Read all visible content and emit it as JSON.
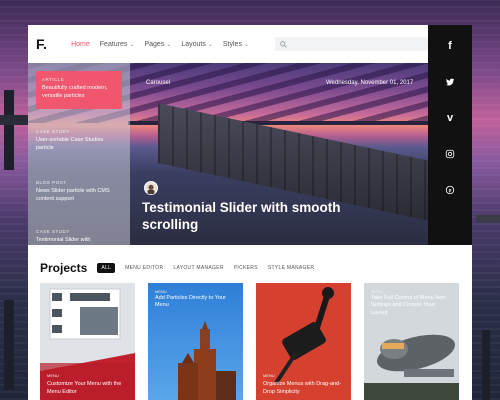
{
  "header": {
    "logo": "F.",
    "nav": [
      {
        "label": "Home",
        "dropdown": false,
        "active": true
      },
      {
        "label": "Features",
        "dropdown": true,
        "active": false
      },
      {
        "label": "Pages",
        "dropdown": true,
        "active": false
      },
      {
        "label": "Layouts",
        "dropdown": true,
        "active": false
      },
      {
        "label": "Styles",
        "dropdown": true,
        "active": false
      }
    ],
    "search": {
      "placeholder": "",
      "icon": "search-icon"
    }
  },
  "social": [
    {
      "name": "facebook-icon",
      "glyph": "f"
    },
    {
      "name": "twitter-icon",
      "glyph": "t"
    },
    {
      "name": "vimeo-icon",
      "glyph": "v"
    },
    {
      "name": "instagram-icon",
      "glyph": "◎"
    },
    {
      "name": "pinterest-icon",
      "glyph": "℗"
    }
  ],
  "hero": {
    "category": "Carousel",
    "date": "Wednesday, November 01, 2017",
    "title": "Testimonial Slider with smooth scrolling",
    "sidebar": [
      {
        "category": "Article",
        "title": "Beautifully crafted modern, versatile particles",
        "active": true
      },
      {
        "category": "Case Study",
        "title": "User-sortable Case Studies particle",
        "active": false
      },
      {
        "category": "Blog Post",
        "title": "News Slider particle with CMS content support",
        "active": false
      },
      {
        "category": "Case Study",
        "title": "Testimonial Slider with",
        "active": false
      }
    ]
  },
  "projects": {
    "title": "Projects",
    "filters": [
      "ALL",
      "MENU EDITOR",
      "LAYOUT MANAGER",
      "PICKERS",
      "STYLE MANAGER"
    ],
    "tiles": [
      {
        "category": "Menu",
        "title": "Customize Your Menu with the Menu Editor",
        "title_pos": "bottom"
      },
      {
        "category": "Menu",
        "title": "Add Particles Directly to Your Menu",
        "title_pos": "top"
      },
      {
        "category": "Menu",
        "title": "Organize Menus with Drag-and-Drop Simplicity",
        "title_pos": "bottom"
      },
      {
        "category": "Menu",
        "title": "Take Full Control of Menu Item Settings and Choose Your Layout",
        "title_pos": "top"
      }
    ]
  },
  "colors": {
    "accent": "#f0566e",
    "dark": "#111111"
  }
}
